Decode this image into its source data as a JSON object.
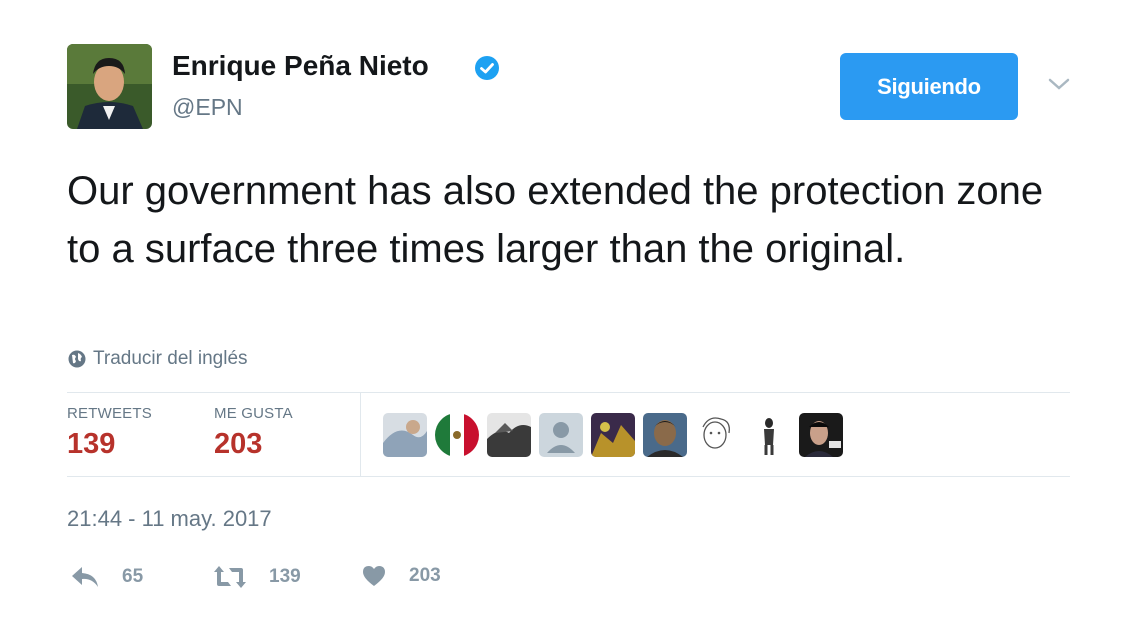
{
  "author": {
    "name": "Enrique Peña Nieto",
    "handle": "@EPN",
    "verified": true
  },
  "follow_button": {
    "label": "Siguiendo"
  },
  "tweet": {
    "text": "Our government has also extended the protection zone to a surface three times larger than the original.",
    "translate_label": "Traducir del inglés",
    "timestamp": "21:44 - 11 may. 2017"
  },
  "stats": {
    "retweets_label": "RETWEETS",
    "retweets_value": "139",
    "likes_label": "ME GUSTA",
    "likes_value": "203"
  },
  "actions": {
    "reply_count": "65",
    "retweet_count": "139",
    "like_count": "203"
  },
  "colors": {
    "accent": "#2b9af2",
    "stat_value": "#b7322b",
    "muted": "#657786"
  }
}
